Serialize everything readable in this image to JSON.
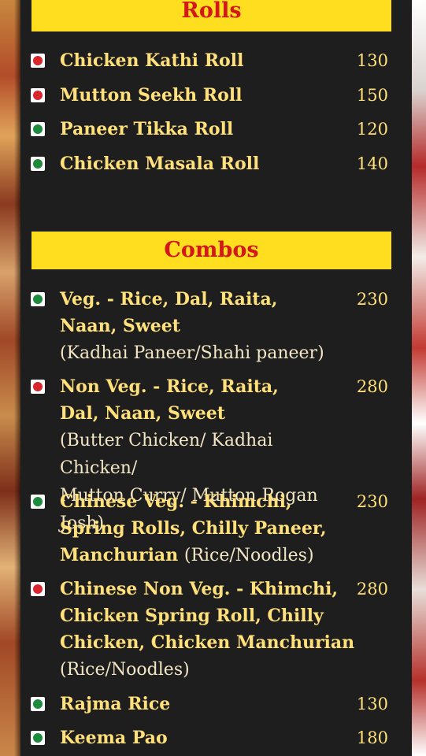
{
  "sections": {
    "rolls": {
      "title": "Rolls"
    },
    "combos": {
      "title": "Combos"
    }
  },
  "rolls": [
    {
      "name": "Chicken Kathi Roll",
      "price": "130",
      "type": "non-veg"
    },
    {
      "name": "Mutton Seekh Roll",
      "price": "150",
      "type": "non-veg"
    },
    {
      "name": "Paneer Tikka Roll",
      "price": "120",
      "type": "veg"
    },
    {
      "name": "Chicken Masala Roll",
      "price": "140",
      "type": "veg"
    }
  ],
  "combos": [
    {
      "name": "Veg. - Rice, Dal, Raita,\nNaan, Sweet",
      "detail": "(Kadhai Paneer/Shahi paneer)",
      "price": "230",
      "type": "veg"
    },
    {
      "name": "Non Veg. - Rice, Raita,\n Dal, Naan, Sweet",
      "detail": "(Butter Chicken/ Kadhai Chicken/\nMutton Curry/ Mutton Rogan Josh)",
      "price": "280",
      "type": "non-veg"
    },
    {
      "name": "Chinese Veg.  - Khimchi,\nSpring Rolls, Chilly Paneer,\nManchurian",
      "detail": "(Rice/Noodles)",
      "price": "230",
      "type": "veg"
    },
    {
      "name": "Chinese Non Veg.  - Khimchi,\nChicken Spring Roll, Chilly\nChicken, Chicken Manchurian",
      "detail": "(Rice/Noodles)",
      "price": "280",
      "type": "non-veg"
    },
    {
      "name": "Rajma Rice",
      "price": "130",
      "type": "veg"
    },
    {
      "name": "Keema Pao",
      "price": "180",
      "type": "veg"
    }
  ],
  "colors": {
    "banner": "#ffde1f",
    "banner_text": "#d21818",
    "item_text": "#ffe07a",
    "veg": "#1e8a3c",
    "non_veg": "#d9262c"
  }
}
